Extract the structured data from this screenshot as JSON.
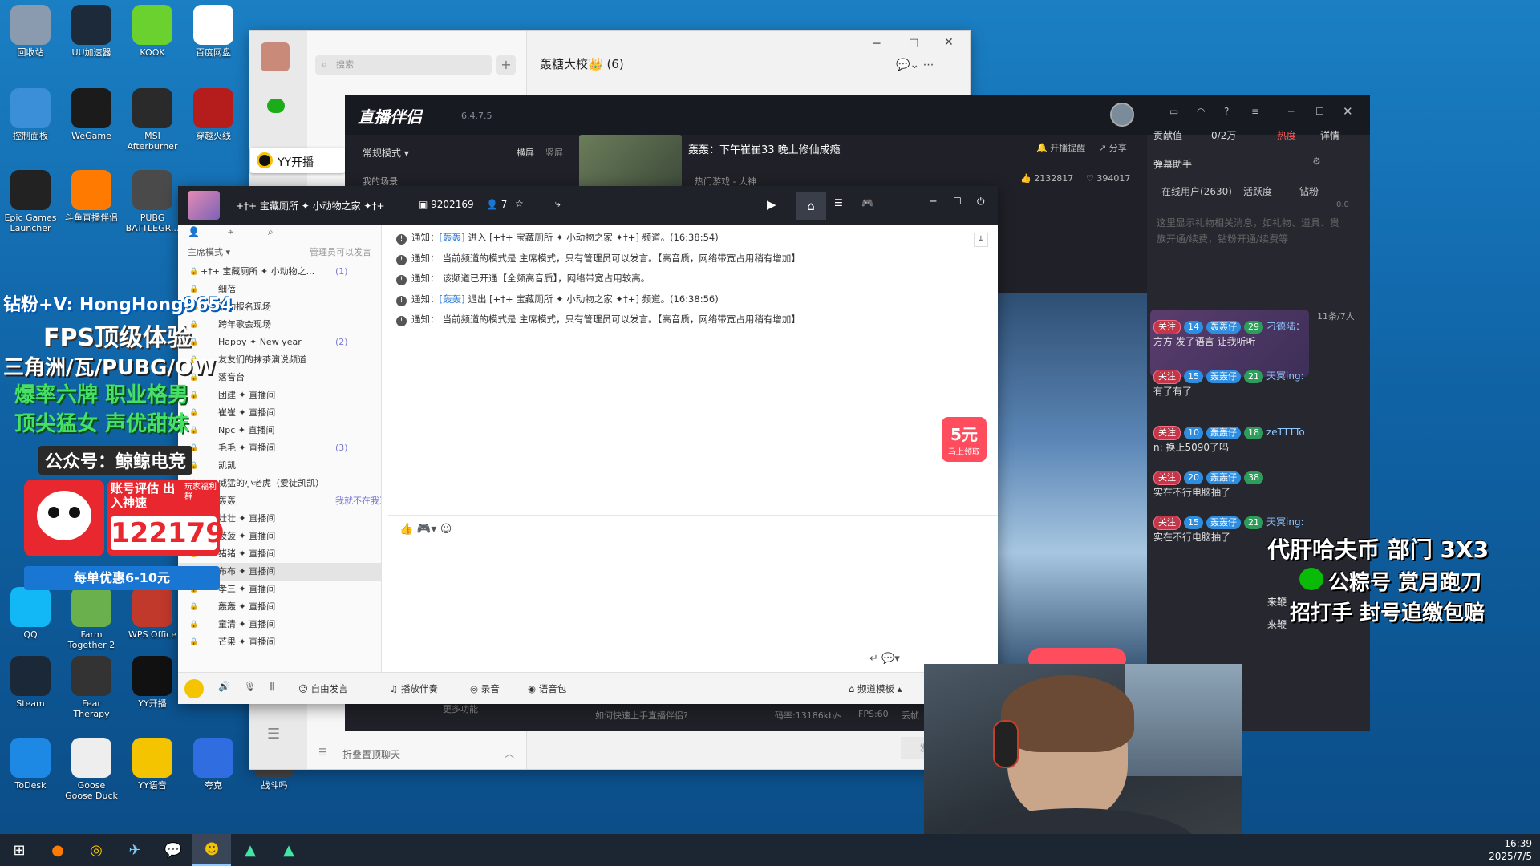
{
  "desktop": {
    "icons": [
      {
        "label": "回收站",
        "icon": "recycle-bin-icon",
        "color": "#8a9bb0"
      },
      {
        "label": "UU加速器",
        "icon": "uu-icon",
        "color": "#1c2a3a"
      },
      {
        "label": "KOOK",
        "icon": "kook-icon",
        "color": "#6bd12f"
      },
      {
        "label": "百度网盘",
        "icon": "baidu-pan-icon",
        "color": "#ffffff"
      },
      {
        "label": "控制面板",
        "icon": "control-panel-icon",
        "color": "#3b8fd9"
      },
      {
        "label": "WeGame",
        "icon": "wegame-icon",
        "color": "#1b1b1b"
      },
      {
        "label": "MSI Afterburner",
        "icon": "msi-icon",
        "color": "#2a2a2a"
      },
      {
        "label": "穿越火线",
        "icon": "cf-icon",
        "color": "#b51c1c"
      },
      {
        "label": "Epic Games Launcher",
        "icon": "epic-icon",
        "color": "#222222"
      },
      {
        "label": "斗鱼直播伴侣",
        "icon": "douyu-icon",
        "color": "#ff7a00"
      },
      {
        "label": "PUBG BATTLEGR...",
        "icon": "pubg-icon",
        "color": "#4a4a4a"
      },
      {
        "label": "QQ",
        "icon": "qq-icon",
        "color": "#12b7f5"
      },
      {
        "label": "Farm Together 2",
        "icon": "farm-icon",
        "color": "#6ab04c"
      },
      {
        "label": "WPS Office",
        "icon": "wps-icon",
        "color": "#c0392b"
      },
      {
        "label": "Steam",
        "icon": "steam-icon",
        "color": "#1b2838"
      },
      {
        "label": "Fear Therapy",
        "icon": "fear-icon",
        "color": "#333333"
      },
      {
        "label": "YY开播",
        "icon": "yy-live-icon",
        "color": "#111111"
      },
      {
        "label": "ToDesk",
        "icon": "todesk-icon",
        "color": "#1e88e5"
      },
      {
        "label": "Goose Goose Duck",
        "icon": "goose-icon",
        "color": "#eeeeee"
      },
      {
        "label": "YY语音",
        "icon": "yy-voice-icon",
        "color": "#f5c400"
      },
      {
        "label": "夸克",
        "icon": "quark-icon",
        "color": "#2f6de1"
      },
      {
        "label": "战斗吗",
        "icon": "game-icon",
        "color": "#444444"
      }
    ],
    "overlays": {
      "line1": "钻粉+V: HongHong9654",
      "line2": "FPS顶级体验",
      "line3": "三角洲/瓦/PUBG/OW",
      "line4": "爆率六牌  职业格男",
      "line5": "顶尖猛女  声优甜妹",
      "line6": "公众号：鲸鲸电竞",
      "promo_title": "账号评估 出入神速",
      "promo_tag": "玩家福利群",
      "promo_number": "122179",
      "promo_footer": "每单优惠6-10元",
      "right1": "代肝哈夫币  部门 3X3",
      "right2": "公粽号  赏月跑刀",
      "right3": "招打手  封号追缴包赔"
    }
  },
  "qq": {
    "search_placeholder": "搜索",
    "chat_title": "轰糖大校👑 (6)",
    "fold_label": "折叠置顶聊天",
    "send_label": "发送"
  },
  "companion": {
    "app_name": "直播伴侣",
    "version": "6.4.7.5",
    "mode": "常规模式",
    "orient_h": "横屏",
    "orient_v": "竖屏",
    "scene_label": "我的场景",
    "stream_title": "轰轰：下午崔崔33 晚上修仙成瘾",
    "category": "热门游戏 - 大神",
    "remind": "开播提醒",
    "share": "分享",
    "likes": "2132817",
    "fans": "394017",
    "contrib_label": "贡献值",
    "contrib_value": "0/2万",
    "hot_label": "热度",
    "detail_label": "详情",
    "danmu_label": "弹幕助手",
    "tabs": [
      "在线用户(2630)",
      "活跃度",
      "钻粉"
    ],
    "empty_hint": "这里显示礼物相关消息，如礼物、道具、贵族开通/续费，钻粉开通/续费等",
    "gift_count": "0.0",
    "room_count": "11条/7人",
    "chat": [
      {
        "level": "14",
        "name": "轰轰仔",
        "fan": "29",
        "user": "刁德陆：",
        "text": "方方 发了语言 让我听听"
      },
      {
        "level": "15",
        "name": "轰轰仔",
        "fan": "21",
        "user": "天冥ing:",
        "text": "有了有了"
      },
      {
        "level": "10",
        "name": "轰轰仔",
        "fan": "18",
        "user": "zeTTTTo",
        "text": "n: 换上5090了吗"
      },
      {
        "level": "20",
        "name": "轰轰仔",
        "fan": "38",
        "user": "",
        "text": "实在不行电脑抽了"
      },
      {
        "level": "15",
        "name": "轰轰仔",
        "fan": "21",
        "user": "天冥ing:",
        "text": "实在不行电脑抽了"
      }
    ],
    "follow_label": "关注",
    "tail1": "来鞭",
    "tail2": "来鞭",
    "bitrate": "码率:13186kb/s",
    "fps": "FPS:60",
    "lost": "丢帧",
    "help": "如何快速上手直播伴侣?",
    "more": "更多功能"
  },
  "yy": {
    "yy_live_label": "YY开播",
    "channel_title": "+†+ 宝藏厕所 ✦ 小动物之家 ✦†+",
    "channel_id": "9202169",
    "online": "7",
    "mode": "主席模式",
    "admin_only": "管理员可以发言",
    "tree": [
      {
        "name": "+†+ 宝藏厕所 ✦ 小动物之...",
        "count": "(1)"
      },
      {
        "name": "细蓓",
        "count": ""
      },
      {
        "name": "活动报名现场",
        "count": ""
      },
      {
        "name": "跨年歌会现场",
        "count": ""
      },
      {
        "name": "Happy ✦ New year",
        "count": "(2)"
      },
      {
        "name": "友友们的抹茶演说频道",
        "count": ""
      },
      {
        "name": "落音台",
        "count": ""
      },
      {
        "name": "团建 ✦ 直播间",
        "count": ""
      },
      {
        "name": "崔崔 ✦ 直播间",
        "count": ""
      },
      {
        "name": "Npc ✦ 直播间",
        "count": ""
      },
      {
        "name": "毛毛 ✦ 直播间",
        "count": "(3)"
      },
      {
        "name": "凯凯",
        "count": ""
      },
      {
        "name": "威猛的小老虎（爱徒凯凯）",
        "count": ""
      },
      {
        "name": "轰轰",
        "count": "我就不在我这"
      },
      {
        "name": "壮壮 ✦ 直播间",
        "count": ""
      },
      {
        "name": "菠菠 ✦ 直播间",
        "count": ""
      },
      {
        "name": "猪猪 ✦ 直播间",
        "count": ""
      },
      {
        "name": "布布 ✦ 直播间",
        "count": ""
      },
      {
        "name": "孝三 ✦ 直播间",
        "count": ""
      },
      {
        "name": "轰轰 ✦ 直播间",
        "count": ""
      },
      {
        "name": "童清 ✦ 直播间",
        "count": ""
      },
      {
        "name": "芒果 ✦ 直播间",
        "count": ""
      }
    ],
    "messages": [
      {
        "prefix": "通知：",
        "user": "[轰轰]",
        "text": "进入 [+†+ 宝藏厕所 ✦ 小动物之家 ✦†+] 频道。(16:38:54)"
      },
      {
        "prefix": "通知：",
        "user": "",
        "text": "当前频道的模式是 主席模式，只有管理员可以发言。【高音质，网络带宽占用稍有增加】"
      },
      {
        "prefix": "通知：",
        "user": "",
        "text": "该频道已开通【全频高音质】，网络带宽占用较高。"
      },
      {
        "prefix": "通知：",
        "user": "[轰轰]",
        "text": "退出 [+†+ 宝藏厕所 ✦ 小动物之家 ✦†+] 频道。(16:38:56)"
      },
      {
        "prefix": "通知：",
        "user": "",
        "text": "当前频道的模式是 主席模式，只有管理员可以发言。【高音质，网络带宽占用稍有增加】"
      }
    ],
    "coupon_amount": "5元",
    "coupon_label": "马上领取",
    "toolbar": {
      "free_speak": "自由发言",
      "play_music": "播放伴奏",
      "record": "录音",
      "voice_pack": "语音包",
      "channel_template": "频道模板"
    }
  },
  "taskbar": {
    "time": "16:39",
    "date": "2025/7/5"
  },
  "colors": {
    "accent": "#ff4d5e",
    "yy_gold": "#f5c400",
    "notice_link": "#2f7cd6"
  }
}
